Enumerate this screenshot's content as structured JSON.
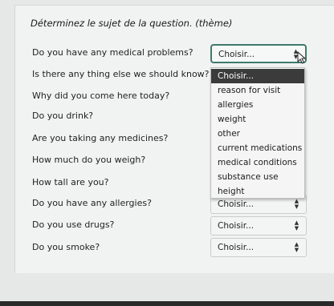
{
  "instruction": "Déterminez le sujet de la question. (thème)",
  "select_placeholder": "Choisir...",
  "questions": [
    {
      "text": "Do you have any medical problems?",
      "value": "Choisir..."
    },
    {
      "text": "Is there any thing else we should know?",
      "value": "Choisir..."
    },
    {
      "text": "Why did you come here today?",
      "value": "Choisir..."
    },
    {
      "text": "Do you drink?",
      "value": "Choisir..."
    },
    {
      "text": "Are you taking any medicines?",
      "value": "Choisir..."
    },
    {
      "text": "How much do you weigh?",
      "value": "Choisir..."
    },
    {
      "text": "How tall are you?",
      "value": "Choisir..."
    },
    {
      "text": "Do you have any allergies?",
      "value": "Choisir..."
    },
    {
      "text": "Do you use drugs?",
      "value": "Choisir..."
    },
    {
      "text": "Do you smoke?",
      "value": "Choisir..."
    }
  ],
  "dropdown_options": [
    "Choisir...",
    "reason for visit",
    "allergies",
    "weight",
    "other",
    "current medications",
    "medical conditions",
    "substance use",
    "height"
  ],
  "colors": {
    "focus_border": "#3f7a6c",
    "selected_option_bg": "#3b3b3b"
  }
}
